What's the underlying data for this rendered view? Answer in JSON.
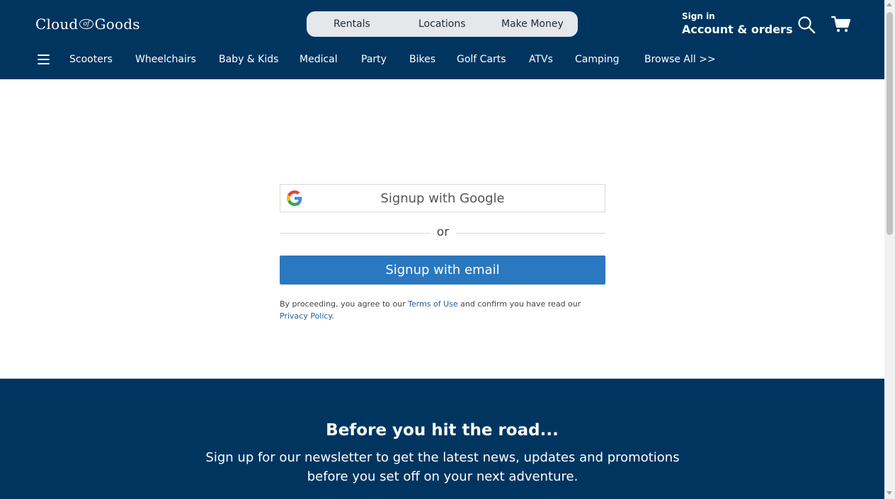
{
  "header": {
    "logo": {
      "part1": "Cloud",
      "of": "of",
      "part2": "Goods"
    },
    "pill_nav": [
      "Rentals",
      "Locations",
      "Make Money"
    ],
    "account": {
      "small": "Sign in",
      "big": "Account & orders"
    },
    "icons": {
      "search": "search-icon",
      "cart": "cart-icon",
      "menu": "hamburger-menu-icon"
    }
  },
  "categories": [
    "Scooters",
    "Wheelchairs",
    "Baby & Kids",
    "Medical",
    "Party",
    "Bikes",
    "Golf Carts",
    "ATVs",
    "Camping",
    "Browse All >>"
  ],
  "signup": {
    "google_label": "Signup with Google",
    "or_text": "or",
    "email_label": "Signup with email",
    "legal": {
      "prefix": "By proceeding, you agree to our ",
      "terms": "Terms of Use",
      "middle": " and confirm you have read our",
      "privacy": "Privacy Policy",
      "suffix": "."
    }
  },
  "newsletter": {
    "title": "Before you hit the road...",
    "text": "Sign up for our newsletter to get the latest news, updates and promotions before you set off on your next adventure."
  },
  "colors": {
    "header_bg": "#003560",
    "primary_button": "#2a78bf",
    "link": "#1f5f9c"
  }
}
